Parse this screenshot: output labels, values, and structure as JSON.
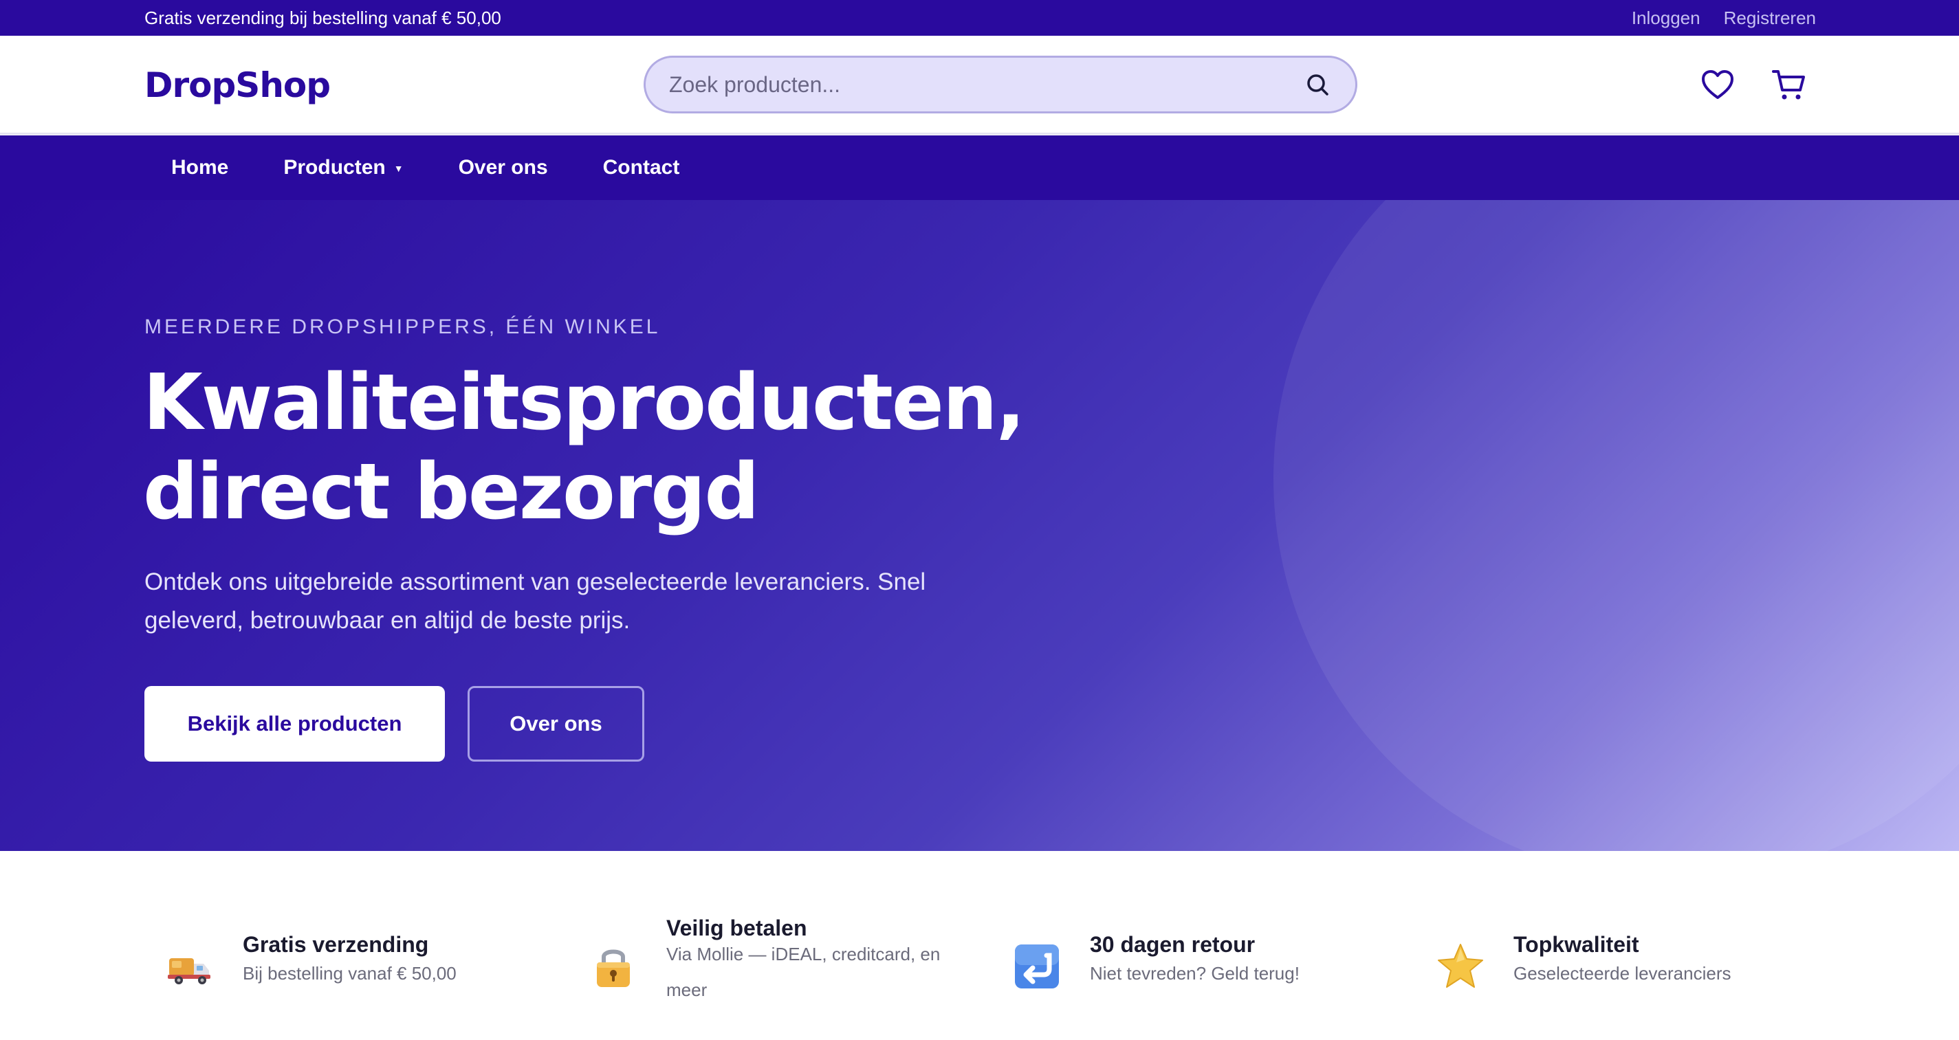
{
  "topbar": {
    "promo": "Gratis verzending bij bestelling vanaf € 50,00",
    "login": "Inloggen",
    "register": "Registreren"
  },
  "header": {
    "logo": "DropShop",
    "search_placeholder": "Zoek producten...",
    "icons": [
      "heart-icon",
      "cart-icon",
      "search-icon"
    ]
  },
  "nav": {
    "items": [
      {
        "label": "Home"
      },
      {
        "label": "Producten"
      },
      {
        "label": "Over ons"
      },
      {
        "label": "Contact"
      }
    ]
  },
  "hero": {
    "eyebrow": "MEERDERE DROPSHIPPERS, ÉÉN WINKEL",
    "title_line1": "Kwaliteitsproducten,",
    "title_line2": "direct bezorgd",
    "lead_line1": "Ontdek ons uitgebreide assortiment van geselecteerde leveranciers. Snel",
    "lead_line2": "geleverd, betrouwbaar en altijd de beste prijs.",
    "cta_primary": "Bekijk alle producten",
    "cta_secondary": "Over ons"
  },
  "features": [
    {
      "icon": "delivery-truck-icon",
      "title": "Gratis verzending",
      "desc": "Bij bestelling vanaf € 50,00"
    },
    {
      "icon": "lock-icon",
      "title": "Veilig betalen",
      "desc": "Via Mollie — iDEAL, creditcard, en meer"
    },
    {
      "icon": "return-arrow-icon",
      "title": "30 dagen retour",
      "desc": "Niet tevreden? Geld terug!"
    },
    {
      "icon": "star-icon",
      "title": "Topkwaliteit",
      "desc": "Geselecteerde leveranciers"
    }
  ],
  "colors": {
    "brand": "#2a0a9e",
    "search_bg": "#e3e0fb",
    "hero_end": "#bdb8f4"
  }
}
